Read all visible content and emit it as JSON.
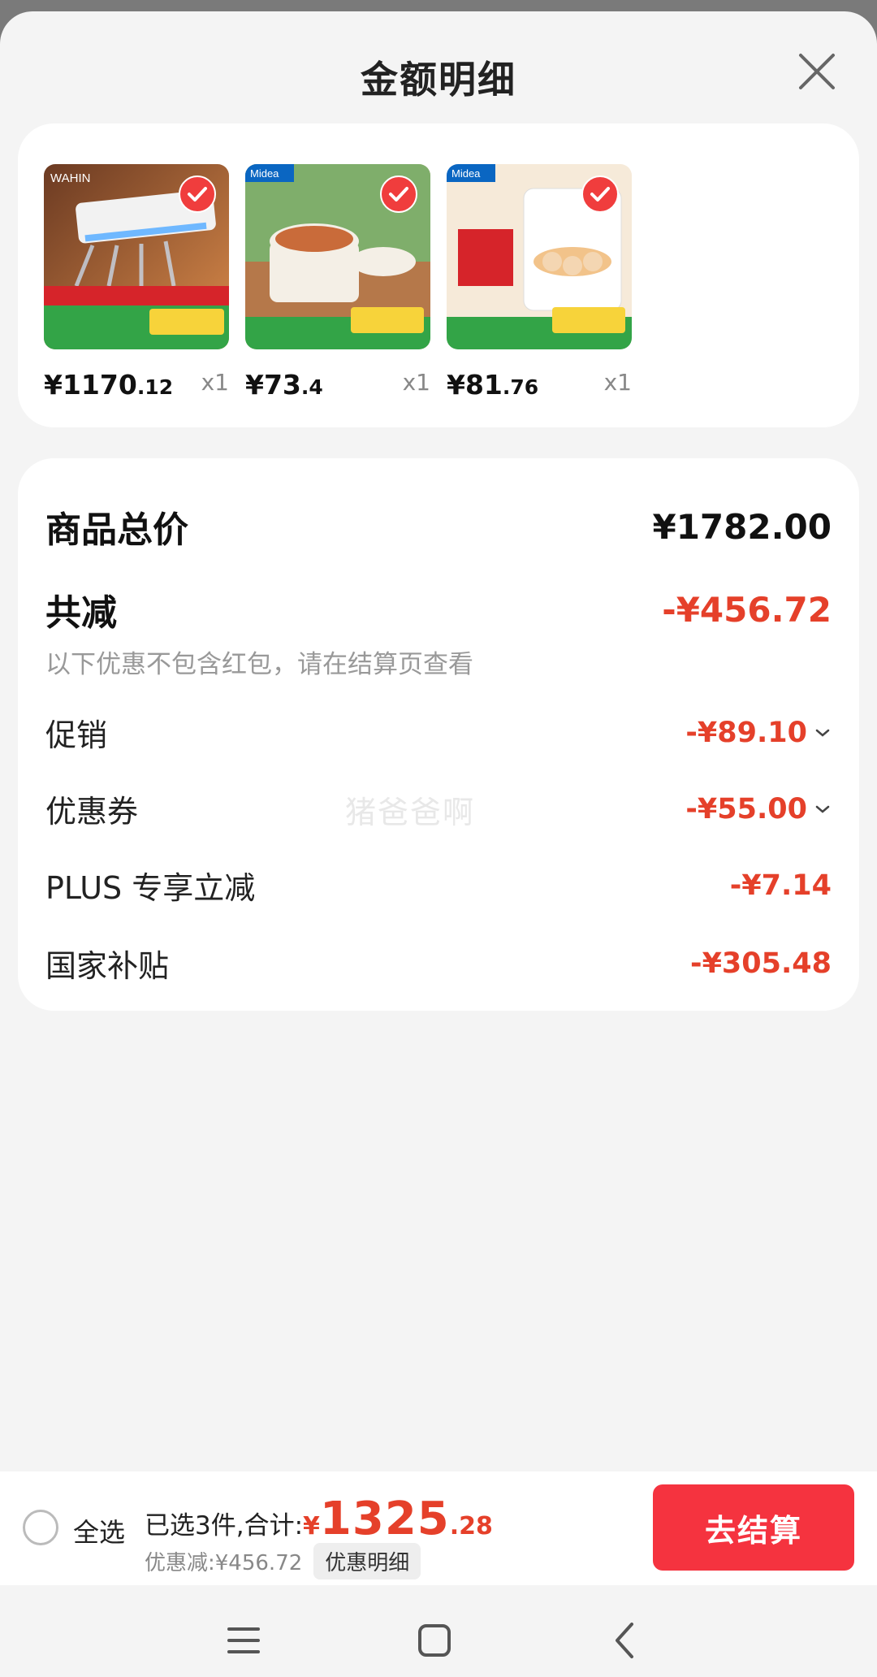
{
  "header": {
    "title": "金额明细"
  },
  "products": [
    {
      "price_int": "¥1170",
      "price_dec": ".12",
      "qty": "x1",
      "brand": "WAHIN",
      "name": "air-conditioner"
    },
    {
      "price_int": "¥73",
      "price_dec": ".4",
      "qty": "x1",
      "brand": "Midea",
      "name": "electric-cooker"
    },
    {
      "price_int": "¥81",
      "price_dec": ".76",
      "qty": "x1",
      "brand": "Midea",
      "name": "egg-steamer"
    }
  ],
  "summary": {
    "total_label": "商品总价",
    "total_value": "¥1782.00",
    "reduce_label": "共减",
    "reduce_value": "-¥456.72",
    "note": "以下优惠不包含红包，请在结算页查看",
    "items": [
      {
        "label": "促销",
        "value": "-¥89.10",
        "expandable": true
      },
      {
        "label": "优惠券",
        "value": "-¥55.00",
        "expandable": true
      },
      {
        "label": "PLUS 专享立减",
        "value": "-¥7.14",
        "expandable": false
      },
      {
        "label": "国家补贴",
        "value": "-¥305.48",
        "expandable": false
      }
    ]
  },
  "watermark": "猪爸爸啊",
  "bottom": {
    "select_all": "全选",
    "selected_text": "已选3件,合计:",
    "currency": "¥",
    "amount_int": "1325",
    "amount_dec": ".28",
    "discount_text": "优惠减:¥456.72",
    "detail_button": "优惠明细",
    "checkout_button": "去结算"
  },
  "colors": {
    "accent": "#f5333f",
    "discount": "#e5402a"
  }
}
